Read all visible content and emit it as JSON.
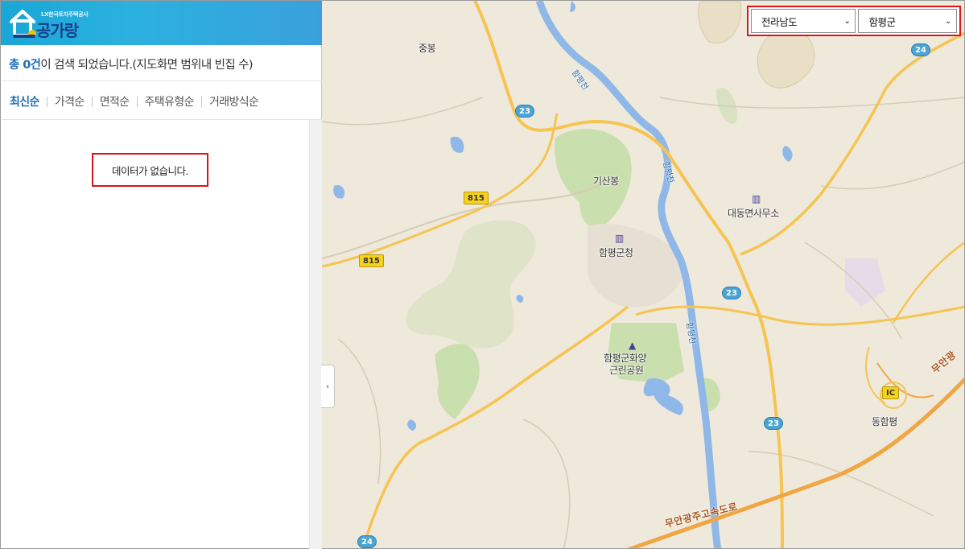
{
  "brand": {
    "lx_text": "LX한국토지주택공사",
    "name": "공가랑"
  },
  "summary": {
    "count": "총 0건",
    "rest": "이 검색 되었습니다.(지도화면 범위내 빈집 수)"
  },
  "sort_tabs": [
    "최신순",
    "가격순",
    "면적순",
    "주택유형순",
    "거래방식순"
  ],
  "no_data_text": "데이터가 없습니다.",
  "collapse_glyph": "‹",
  "region": {
    "province": "전라남도",
    "county": "함평군"
  },
  "map": {
    "labels": {
      "jungbong": "중봉",
      "gisanbong": "기산봉",
      "daedong_office": "대동면사무소",
      "hampyeong_office": "함평군청",
      "park_line1": "함평군화양",
      "park_line2": "근린공원",
      "dong_hampyeong": "동함평",
      "ic": "IC"
    },
    "rivers": {
      "upper": "함평천",
      "middle": "함평천",
      "lower": "함평천"
    },
    "expressway": "무안광주고속도로",
    "expressway_edge": "무안광",
    "routes": {
      "r23_a": "23",
      "r23_b": "23",
      "r23_c": "23",
      "r24_a": "24",
      "r24_b": "24",
      "r815_a": "815",
      "r815_b": "815"
    },
    "colors": {
      "land": "#efe9dc",
      "forest": "#cadfae",
      "water": "#8fb8e8",
      "main_road": "#f5c451",
      "expressway": "#f0a643"
    }
  }
}
